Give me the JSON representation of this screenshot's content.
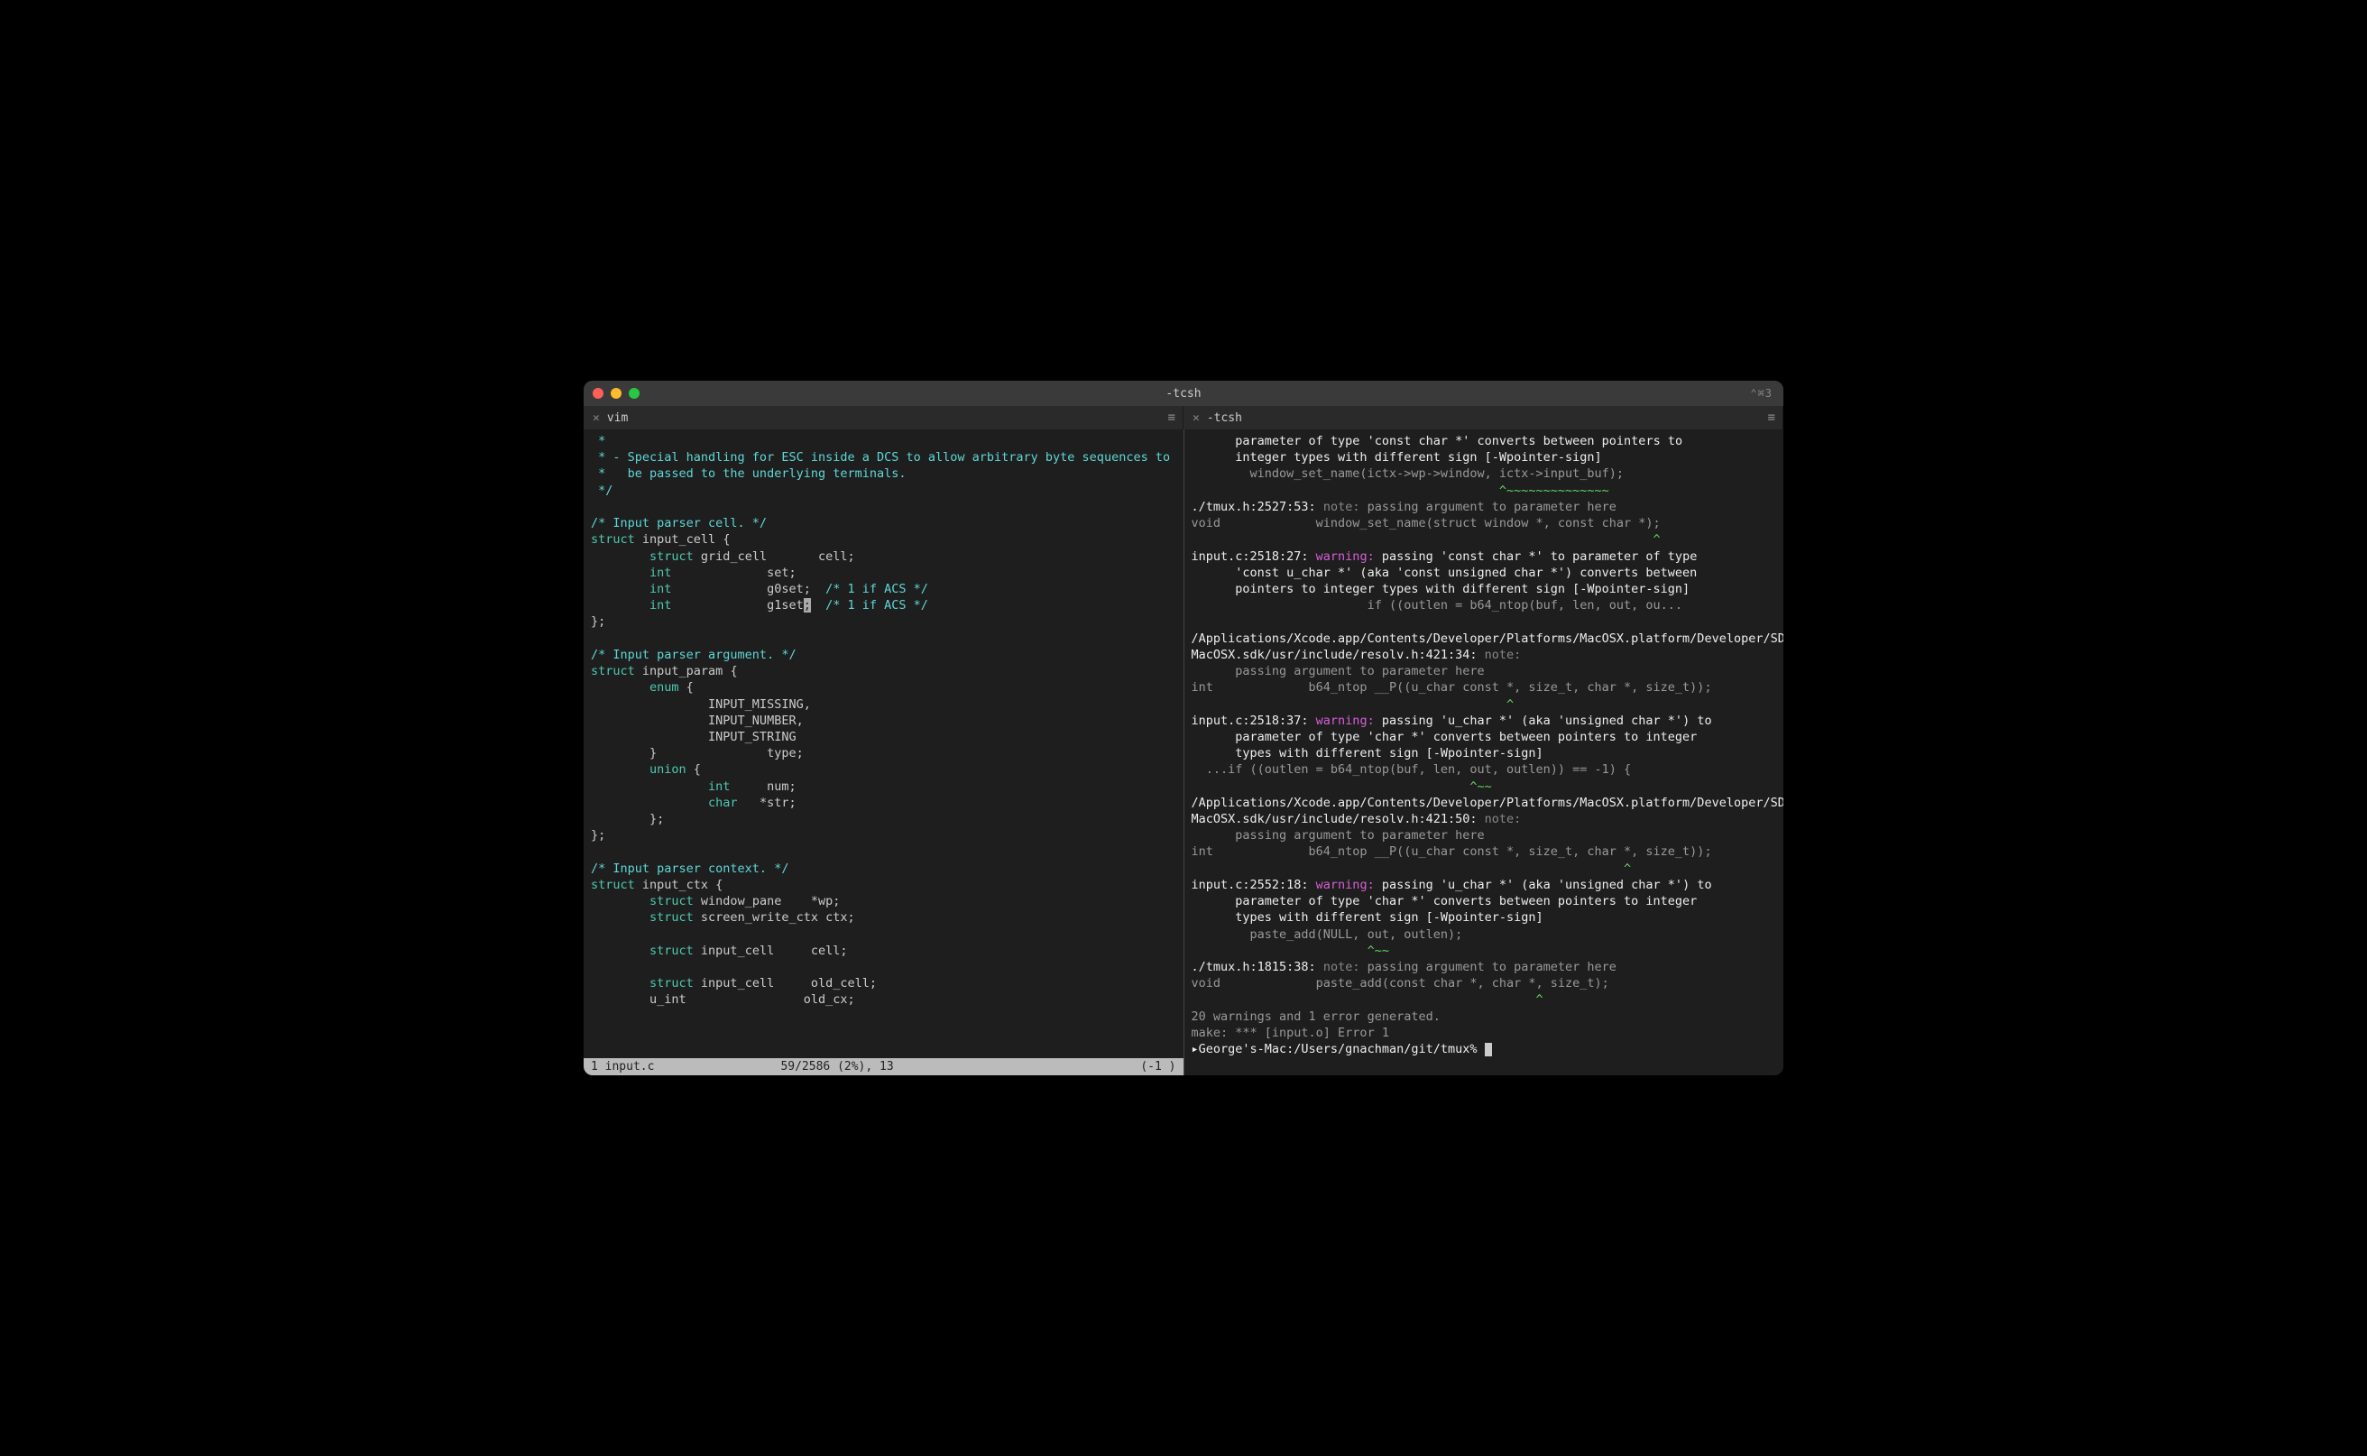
{
  "window": {
    "title": "-tcsh",
    "right_indicator": "⌃⌘3"
  },
  "tabs": {
    "left": {
      "label": "vim"
    },
    "right": {
      "label": "-tcsh"
    }
  },
  "left_pane": {
    "code": {
      "l1": " *",
      "l2": " * - Special handling for ESC inside a DCS to allow arbitrary byte sequences to",
      "l3": " *   be passed to the underlying terminals.",
      "l4": " */",
      "l5": "",
      "l6": "/* Input parser cell. */",
      "struct1_kw": "struct",
      "struct1_name": " input_cell {",
      "s1f1_kw": "        struct",
      "s1f1_rest": " grid_cell       cell;",
      "s1f2_kw": "        int",
      "s1f2_rest": "             set;",
      "s1f3_kw": "        int",
      "s1f3_rest": "             g0set;  ",
      "s1f3_cmt": "/* 1 if ACS */",
      "s1f4_kw": "        int",
      "s1f4_rest": "             g1set",
      "s1f4_cursor": ";",
      "s1f4_cmt": "  /* 1 if ACS */",
      "close1": "};",
      "l_blank2": "",
      "l_cmt2": "/* Input parser argument. */",
      "struct2_kw": "struct",
      "struct2_name": " input_param {",
      "enum_kw": "        enum",
      "enum_open": " {",
      "enum1": "                INPUT_MISSING,",
      "enum2": "                INPUT_NUMBER,",
      "enum3": "                INPUT_STRING",
      "enum_close": "        }               type;",
      "union_kw": "        union",
      "union_open": " {",
      "uf1_kw": "                int",
      "uf1_rest": "     num;",
      "uf2_kw": "                char",
      "uf2_rest": "   *str;",
      "union_close": "        };",
      "close2": "};",
      "l_blank3": "",
      "l_cmt3": "/* Input parser context. */",
      "struct3_kw": "struct",
      "struct3_name": " input_ctx {",
      "s3f1_kw": "        struct",
      "s3f1_rest": " window_pane    *wp;",
      "s3f2_kw": "        struct",
      "s3f2_rest": " screen_write_ctx ctx;",
      "l_blank4": "",
      "s3f3_kw": "        struct",
      "s3f3_rest": " input_cell     cell;",
      "l_blank5": "",
      "s3f4_kw": "        struct",
      "s3f4_rest": " input_cell     old_cell;",
      "s3f5_rest": "        u_int                old_cx;"
    },
    "status": {
      "left": "1 input.c",
      "center": "59/2586 (2%), 13",
      "right": "(-1 )"
    }
  },
  "right_pane": {
    "lines": {
      "r1a": "      parameter of type ",
      "r1b": "'const char *'",
      "r1c": " converts between pointers to",
      "r2a": "      integer types with different sign [-Wpointer-sign]",
      "r3a": "        window_set_name(ictx->wp->window, ictx->input_buf);",
      "r3u": "                                          ^~~~~~~~~~~~~~~",
      "r4a": "./tmux.h:2527:53: ",
      "r4b": "note: ",
      "r4c": "passing argument to parameter here",
      "r5a": "void             window_set_name(struct window *, const char *);",
      "r5u": "                                                               ^",
      "r6a": "input.c:2518:27: ",
      "r6b": "warning: ",
      "r6c": "passing 'const char *' to parameter of type",
      "r7a": "      'const u_char *' (aka 'const unsigned char *') converts between",
      "r8a": "      pointers to integer types with different sign [-Wpointer-sign]",
      "r9a": "                        if ((outlen = b64_ntop(buf, len, out, ou...",
      "r10a": "/Applications/Xcode.app/Contents/Developer/Platforms/MacOSX.platform/Developer/SDKs/",
      "r10b": "MacOSX.sdk/usr/include/resolv.h:421:34: ",
      "r10c": "note:",
      "r11a": "      passing argument to parameter here",
      "r12a": "int             b64_ntop __P((u_char const *, size_t, char *, size_t));",
      "r12u": "                                           ^",
      "r13a": "input.c:2518:37: ",
      "r13b": "warning: ",
      "r13c": "passing 'u_char *' (aka 'unsigned char *') to",
      "r14a": "      parameter of type 'char *' converts between pointers to integer",
      "r15a": "      types with different sign [-Wpointer-sign]",
      "r16a": "  ...if ((outlen = b64_ntop(buf, len, out, outlen)) == -1) {",
      "r16u": "                                      ^~~",
      "r17a": "/Applications/Xcode.app/Contents/Developer/Platforms/MacOSX.platform/Developer/SDKs/",
      "r17b": "MacOSX.sdk/usr/include/resolv.h:421:50: ",
      "r17c": "note:",
      "r18a": "      passing argument to parameter here",
      "r19a": "int             b64_ntop __P((u_char const *, size_t, char *, size_t));",
      "r19u": "                                                           ^",
      "r20a": "input.c:2552:18: ",
      "r20b": "warning: ",
      "r20c": "passing 'u_char *' (aka 'unsigned char *') to",
      "r21a": "      parameter of type 'char *' converts between pointers to integer",
      "r22a": "      types with different sign [-Wpointer-sign]",
      "r23a": "        paste_add(NULL, out, outlen);",
      "r23u": "                        ^~~",
      "r24a": "./tmux.h:1815:38: ",
      "r24b": "note: ",
      "r24c": "passing argument to parameter here",
      "r25a": "void             paste_add(const char *, char *, size_t);",
      "r25u": "                                               ^",
      "r26a": "20 warnings and 1 error generated.",
      "r27a": "make: *** [input.o] Error 1",
      "r28a": "▸George's-Mac:/Users/gnachman/git/tmux% "
    }
  }
}
